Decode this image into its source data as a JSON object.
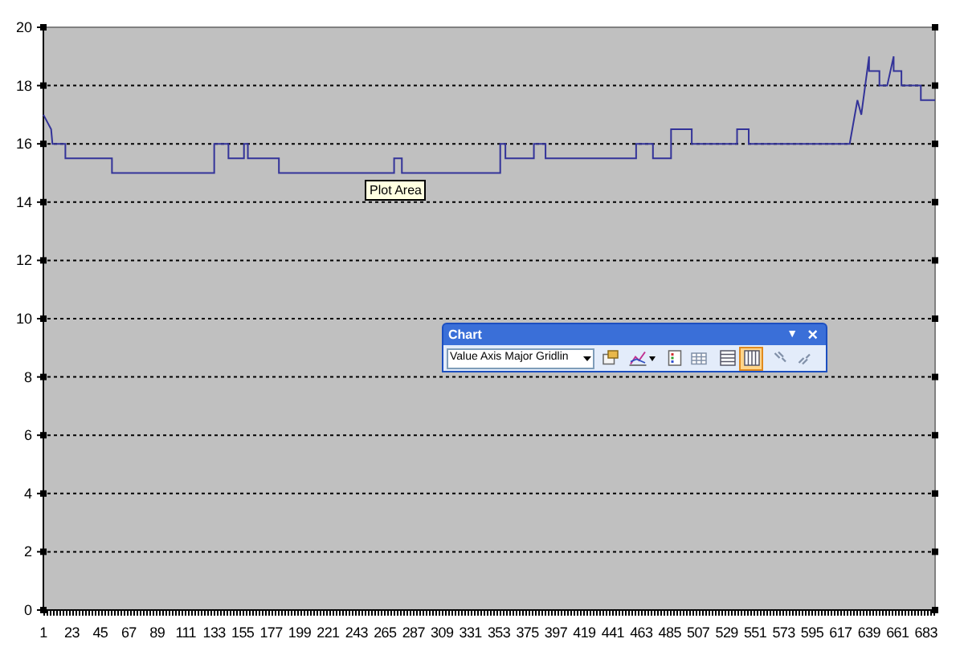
{
  "chart": {
    "chart_data": {
      "type": "line",
      "x": [
        1,
        7,
        8,
        18,
        18,
        54,
        54,
        133,
        133,
        144,
        144,
        156,
        156,
        159,
        159,
        183,
        183,
        272,
        272,
        278,
        278,
        354,
        354,
        358,
        358,
        380,
        380,
        389,
        389,
        459,
        459,
        472,
        472,
        486,
        486,
        502,
        502,
        537,
        537,
        546,
        546,
        624,
        630,
        633,
        639,
        639,
        647,
        647,
        653,
        658,
        658,
        664,
        664,
        679,
        679,
        690
      ],
      "series": [
        {
          "color": "#333399",
          "values": [
            17,
            16.5,
            16,
            16,
            15.5,
            15.5,
            15,
            15,
            16,
            16,
            15.5,
            15.5,
            16,
            16,
            15.5,
            15.5,
            15,
            15,
            15.5,
            15.5,
            15,
            15,
            16,
            16,
            15.5,
            15.5,
            16,
            16,
            15.5,
            15.5,
            16,
            16,
            15.5,
            15.5,
            16.5,
            16.5,
            16,
            16,
            16.5,
            16.5,
            16,
            16,
            17.5,
            17,
            19,
            18.5,
            18.5,
            18,
            18,
            19,
            18.5,
            18.5,
            18,
            18,
            17.5,
            17.5
          ]
        }
      ],
      "xlim": [
        1,
        690
      ],
      "grid": true,
      "ylim": [
        0,
        20
      ],
      "yticks": [
        0,
        2,
        4,
        6,
        8,
        10,
        12,
        14,
        16,
        18,
        20
      ],
      "xticks": [
        1,
        23,
        45,
        67,
        89,
        111,
        133,
        155,
        177,
        199,
        221,
        243,
        265,
        287,
        309,
        331,
        353,
        375,
        397,
        419,
        441,
        463,
        485,
        507,
        529,
        551,
        573,
        595,
        617,
        639,
        661,
        683
      ]
    }
  },
  "tooltip": {
    "text": "Plot Area"
  },
  "toolbar": {
    "title": "Chart",
    "menu_glyph": "▼",
    "close_glyph": "×",
    "object_field": {
      "value": "Value Axis Major Gridlin"
    },
    "buttons": [
      {
        "kind": "format",
        "selected": false
      },
      {
        "kind": "chart-type",
        "selected": false
      },
      {
        "kind": "legend",
        "selected": false
      },
      {
        "kind": "data-table",
        "selected": false
      },
      {
        "kind": "by-row",
        "selected": false
      },
      {
        "kind": "by-column",
        "selected": true
      },
      {
        "kind": "angle-down",
        "selected": false
      },
      {
        "kind": "angle-up",
        "selected": false
      }
    ]
  }
}
